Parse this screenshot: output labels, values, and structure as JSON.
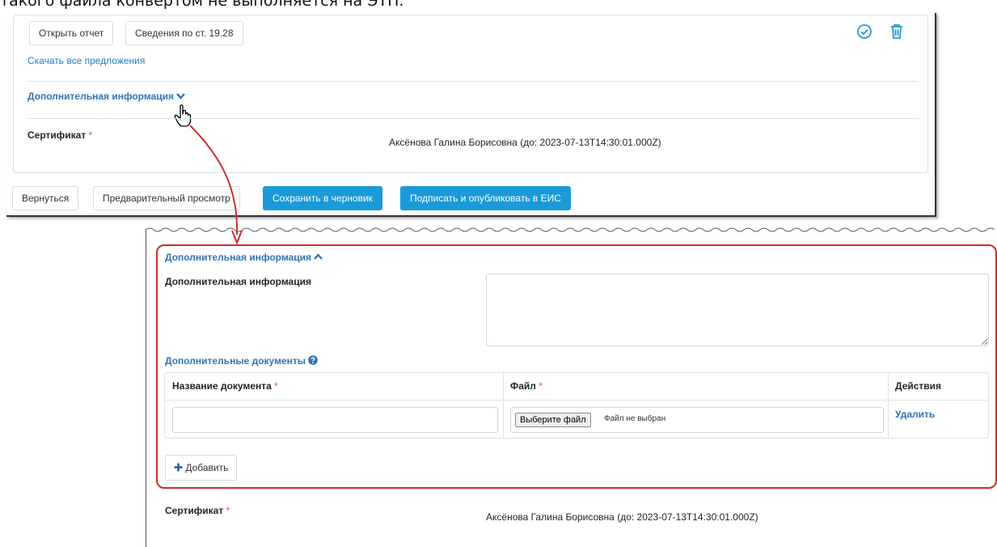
{
  "doc_text": "такого файла конвертом не выполняется на ЭТП.",
  "top": {
    "open_report": "Открыть отчет",
    "article_info": "Сведения по ст. 19.28",
    "download_all": "Скачать все предложения",
    "extra_info_toggle": "Дополнительная информация",
    "certificate_label": "Сертификат",
    "certificate_value": "Аксёнова Галина Борисовна (до: 2023-07-13T14:30:01.000Z)",
    "back": "Вернуться",
    "preview": "Предварительный просмотр",
    "save_draft": "Сохранить в черновик",
    "sign_publish": "Подписать и опубликовать в ЕИС"
  },
  "bottom": {
    "extra_info_toggle": "Дополнительная информация",
    "extra_info_label": "Дополнительная информация",
    "extra_docs_title": "Дополнительные документы",
    "table": {
      "col_name": "Название документа",
      "col_file": "Файл",
      "col_actions": "Действия",
      "row": {
        "file_button": "Выберите файл",
        "file_status": "Файл не выбран",
        "delete": "Удалить"
      }
    },
    "add_button": "Добавить",
    "certificate_label": "Сертификат",
    "certificate_value": "Аксёнова Галина Борисовна (до: 2023-07-13T14:30:01.000Z)"
  },
  "required_mark": "*",
  "colors": {
    "primary": "#1a9bd8",
    "link": "#2f74b5",
    "required": "#e74c3c",
    "highlight": "#c9302c"
  }
}
